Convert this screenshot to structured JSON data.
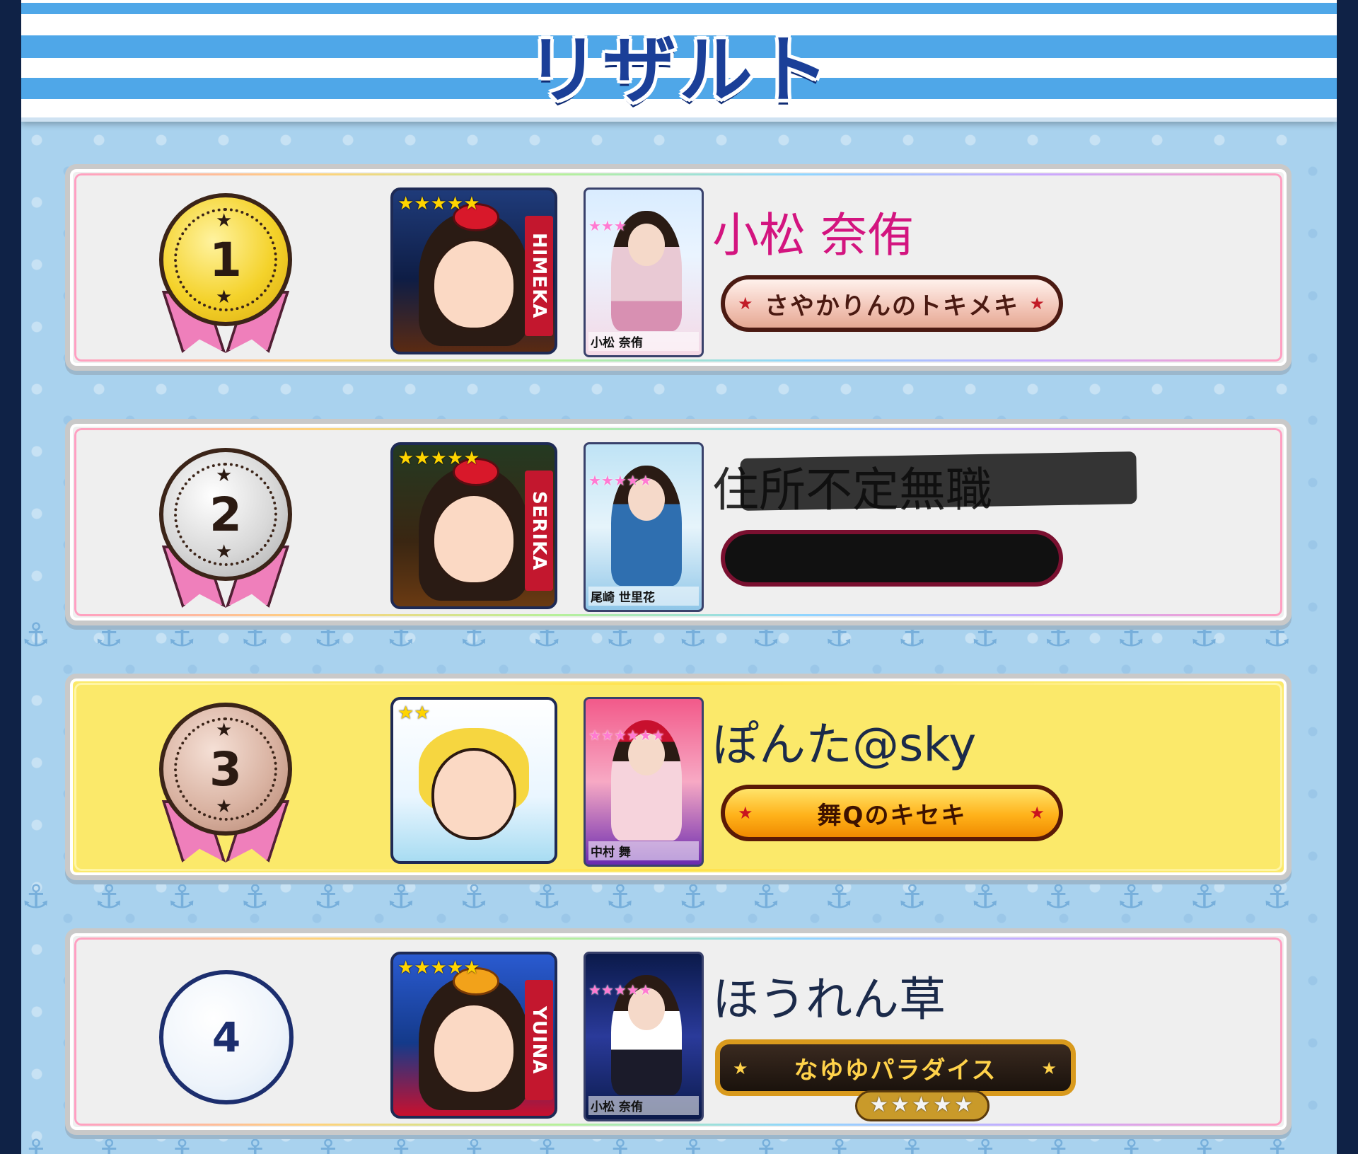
{
  "header": {
    "title": "リザルト"
  },
  "players": [
    {
      "rank": "1",
      "medal": "gold",
      "name": "小松 奈侑",
      "name_color": "#d3147f",
      "avatar_label": "HIMEKA",
      "avatar_stars": "★★★★★",
      "card_name": "小松 奈侑",
      "card_rarity": "★★★",
      "badge_title": "さやかりんのトキメキ",
      "badge_style": "pink",
      "highlight": false
    },
    {
      "rank": "2",
      "medal": "silver",
      "name": "住所不定無職",
      "name_color": "#2a2a2a",
      "avatar_label": "SERIKA",
      "avatar_stars": "★★★★★",
      "card_name": "尾崎 世里花",
      "card_rarity": "★★★★★",
      "badge_title": "",
      "badge_style": "redacted",
      "highlight": false
    },
    {
      "rank": "3",
      "medal": "bronze",
      "name": "ぽんた@sky",
      "name_color": "#1b2a4a",
      "avatar_label": "",
      "avatar_stars": "★★",
      "card_name": "中村 舞",
      "card_rarity": "★★★★★★",
      "badge_title": "舞Qのキセキ",
      "badge_style": "orange",
      "highlight": true
    },
    {
      "rank": "4",
      "medal": "plain",
      "name": "ほうれん草",
      "name_color": "#1b2a4a",
      "avatar_label": "YUINA",
      "avatar_stars": "★★★★★",
      "card_name": "小松 奈侑",
      "card_rarity": "★★★★★",
      "badge_title": "なゆゆパラダイス",
      "badge_style": "black",
      "badge_stars": "★★★★★",
      "highlight": false
    }
  ],
  "colors": {
    "accent_blue": "#4fa7e8",
    "title_navy": "#1b3f98",
    "highlight_yellow": "#fbe96a"
  },
  "icons": {
    "row_background": "anchor-icon",
    "medal_decoration": "star-icon"
  }
}
